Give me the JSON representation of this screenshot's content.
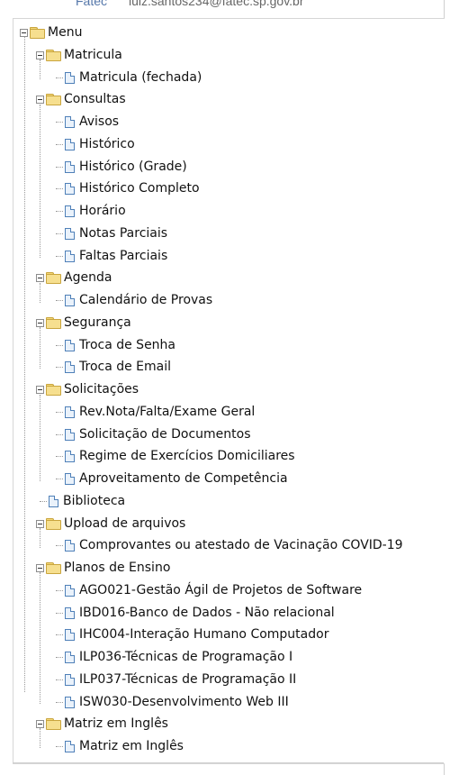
{
  "header": {
    "brand": "Fatec",
    "email": "luiz.santos234@fatec.sp.gov.br"
  },
  "menu": {
    "root": "Menu",
    "matricula": {
      "label": "Matricula",
      "items": [
        "Matricula (fechada)"
      ]
    },
    "consultas": {
      "label": "Consultas",
      "items": [
        "Avisos",
        "Histórico",
        "Histórico (Grade)",
        "Histórico Completo",
        "Horário",
        "Notas Parciais",
        "Faltas Parciais"
      ]
    },
    "agenda": {
      "label": "Agenda",
      "items": [
        "Calendário de Provas"
      ]
    },
    "seguranca": {
      "label": "Segurança",
      "items": [
        "Troca de Senha",
        "Troca de Email"
      ]
    },
    "solicitacoes": {
      "label": "Solicitações",
      "items": [
        "Rev.Nota/Falta/Exame Geral",
        "Solicitação de Documentos",
        "Regime de Exercícios Domiciliares",
        "Aproveitamento de Competência"
      ]
    },
    "biblioteca": {
      "label": "Biblioteca"
    },
    "upload": {
      "label": "Upload de arquivos",
      "items": [
        "Comprovantes ou atestado de Vacinação COVID-19"
      ]
    },
    "planos": {
      "label": "Planos de Ensino",
      "items": [
        "AGO021-Gestão Ágil de Projetos de Software",
        "IBD016-Banco de Dados - Não relacional",
        "IHC004-Interação Humano Computador",
        "ILP036-Técnicas de Programação I",
        "ILP037-Técnicas de Programação II",
        "ISW030-Desenvolvimento Web III"
      ]
    },
    "matriz": {
      "label": "Matriz em Inglês",
      "items": [
        "Matriz em Inglês"
      ]
    }
  }
}
